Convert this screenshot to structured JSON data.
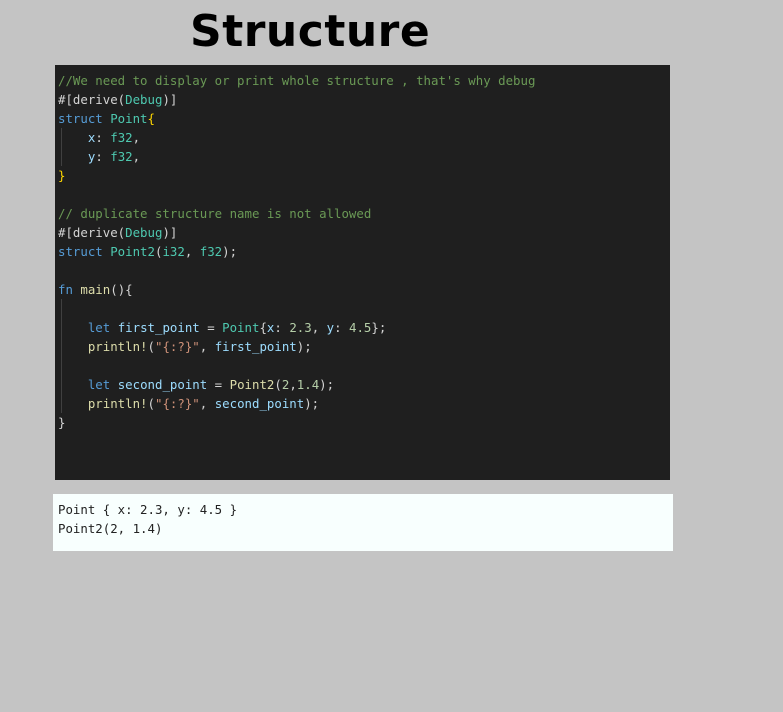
{
  "page": {
    "title": "Structure"
  },
  "code": {
    "language": "rust",
    "lines": [
      {
        "tokens": [
          {
            "t": "//We need to display or print whole structure , that's why debug",
            "c": "comment"
          }
        ]
      },
      {
        "tokens": [
          {
            "t": "#[derive(",
            "c": "plain"
          },
          {
            "t": "Debug",
            "c": "type"
          },
          {
            "t": ")]",
            "c": "plain"
          }
        ]
      },
      {
        "tokens": [
          {
            "t": "struct ",
            "c": "keyword"
          },
          {
            "t": "Point",
            "c": "type"
          },
          {
            "t": "{",
            "c": "brace"
          }
        ]
      },
      {
        "guide": true,
        "tokens": [
          {
            "t": "    ",
            "c": "plain"
          },
          {
            "t": "x",
            "c": "var"
          },
          {
            "t": ": ",
            "c": "plain"
          },
          {
            "t": "f32",
            "c": "type"
          },
          {
            "t": ",",
            "c": "plain"
          }
        ]
      },
      {
        "guide": true,
        "tokens": [
          {
            "t": "    ",
            "c": "plain"
          },
          {
            "t": "y",
            "c": "var"
          },
          {
            "t": ": ",
            "c": "plain"
          },
          {
            "t": "f32",
            "c": "type"
          },
          {
            "t": ",",
            "c": "plain"
          }
        ]
      },
      {
        "tokens": [
          {
            "t": "}",
            "c": "brace"
          }
        ]
      },
      {
        "tokens": []
      },
      {
        "tokens": [
          {
            "t": "// duplicate structure name is not allowed",
            "c": "comment"
          }
        ]
      },
      {
        "tokens": [
          {
            "t": "#[derive(",
            "c": "plain"
          },
          {
            "t": "Debug",
            "c": "type"
          },
          {
            "t": ")]",
            "c": "plain"
          }
        ]
      },
      {
        "tokens": [
          {
            "t": "struct ",
            "c": "keyword"
          },
          {
            "t": "Point2",
            "c": "type"
          },
          {
            "t": "(",
            "c": "plain"
          },
          {
            "t": "i32",
            "c": "type"
          },
          {
            "t": ", ",
            "c": "plain"
          },
          {
            "t": "f32",
            "c": "type"
          },
          {
            "t": ");",
            "c": "plain"
          }
        ]
      },
      {
        "tokens": []
      },
      {
        "tokens": [
          {
            "t": "fn ",
            "c": "keyword"
          },
          {
            "t": "main",
            "c": "func"
          },
          {
            "t": "(){",
            "c": "plain"
          }
        ]
      },
      {
        "guide": true,
        "tokens": []
      },
      {
        "guide": true,
        "tokens": [
          {
            "t": "    ",
            "c": "plain"
          },
          {
            "t": "let ",
            "c": "keyword"
          },
          {
            "t": "first_point",
            "c": "var"
          },
          {
            "t": " = ",
            "c": "plain"
          },
          {
            "t": "Point",
            "c": "type"
          },
          {
            "t": "{",
            "c": "plain"
          },
          {
            "t": "x",
            "c": "var"
          },
          {
            "t": ": ",
            "c": "plain"
          },
          {
            "t": "2.3",
            "c": "number"
          },
          {
            "t": ", ",
            "c": "plain"
          },
          {
            "t": "y",
            "c": "var"
          },
          {
            "t": ": ",
            "c": "plain"
          },
          {
            "t": "4.5",
            "c": "number"
          },
          {
            "t": "};",
            "c": "plain"
          }
        ]
      },
      {
        "guide": true,
        "tokens": [
          {
            "t": "    ",
            "c": "plain"
          },
          {
            "t": "println!",
            "c": "func"
          },
          {
            "t": "(",
            "c": "plain"
          },
          {
            "t": "\"{:?}\"",
            "c": "string"
          },
          {
            "t": ", ",
            "c": "plain"
          },
          {
            "t": "first_point",
            "c": "var"
          },
          {
            "t": ");",
            "c": "plain"
          }
        ]
      },
      {
        "guide": true,
        "tokens": []
      },
      {
        "guide": true,
        "tokens": [
          {
            "t": "    ",
            "c": "plain"
          },
          {
            "t": "let ",
            "c": "keyword"
          },
          {
            "t": "second_point",
            "c": "var"
          },
          {
            "t": " = ",
            "c": "plain"
          },
          {
            "t": "Point2",
            "c": "func"
          },
          {
            "t": "(",
            "c": "plain"
          },
          {
            "t": "2",
            "c": "number"
          },
          {
            "t": ",",
            "c": "plain"
          },
          {
            "t": "1.4",
            "c": "number"
          },
          {
            "t": ");",
            "c": "plain"
          }
        ]
      },
      {
        "guide": true,
        "tokens": [
          {
            "t": "    ",
            "c": "plain"
          },
          {
            "t": "println!",
            "c": "func"
          },
          {
            "t": "(",
            "c": "plain"
          },
          {
            "t": "\"{:?}\"",
            "c": "string"
          },
          {
            "t": ", ",
            "c": "plain"
          },
          {
            "t": "second_point",
            "c": "var"
          },
          {
            "t": ");",
            "c": "plain"
          }
        ]
      },
      {
        "tokens": [
          {
            "t": "}",
            "c": "plain"
          }
        ]
      }
    ]
  },
  "output": {
    "lines": [
      "Point { x: 2.3, y: 4.5 }",
      "Point2(2, 1.4)"
    ]
  },
  "colors": {
    "page_background": "#c4c4c4",
    "code_background": "#1f1f1f",
    "output_background": "#f8fffe",
    "comment": "#6a9955",
    "keyword": "#569cd6",
    "type": "#4ec9b0",
    "variable": "#9cdcfe",
    "function": "#dcdcaa",
    "string": "#ce9178",
    "number": "#b5cea8"
  }
}
